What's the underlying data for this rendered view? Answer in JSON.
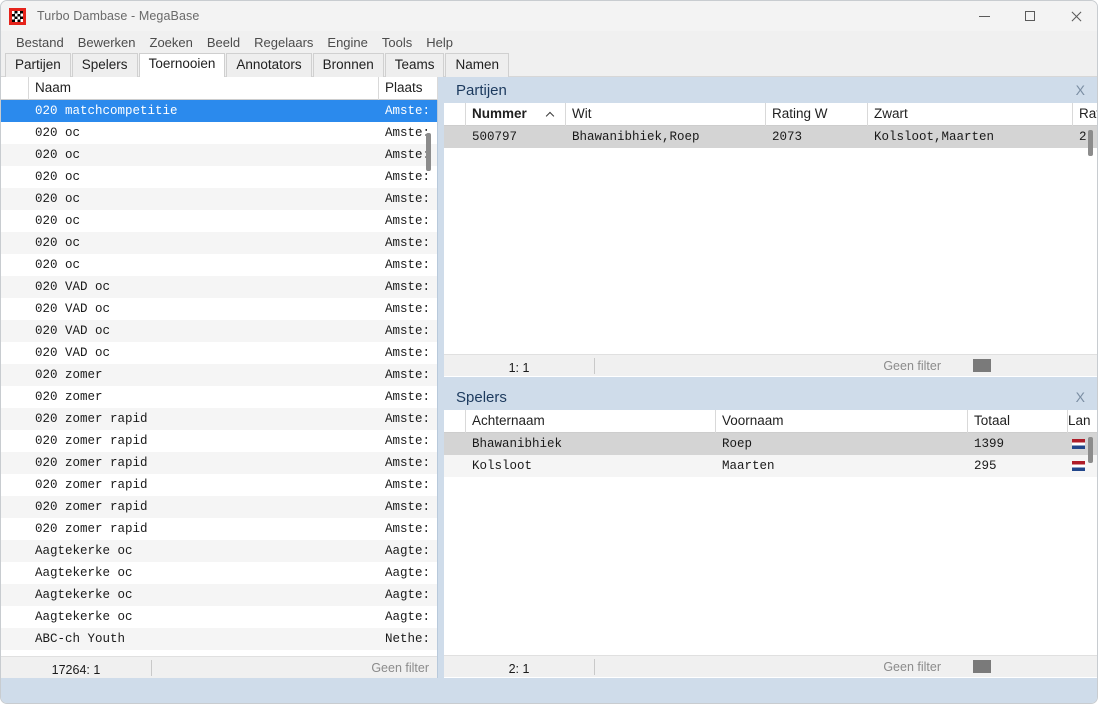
{
  "window": {
    "title": "Turbo Dambase - MegaBase",
    "app_icon": "checkerboard-icon",
    "controls": {
      "minimize": "minimize-icon",
      "maximize": "maximize-icon",
      "close": "close-icon"
    }
  },
  "menubar": {
    "items": [
      "Bestand",
      "Bewerken",
      "Zoeken",
      "Beeld",
      "Regelaars",
      "Engine",
      "Tools",
      "Help"
    ]
  },
  "tabs": {
    "items": [
      "Partijen",
      "Spelers",
      "Toernooien",
      "Annotators",
      "Bronnen",
      "Teams",
      "Namen"
    ],
    "active": "Toernooien"
  },
  "tournaments_grid": {
    "columns": [
      "",
      "Naam",
      "Plaats"
    ],
    "rows": [
      {
        "naam": "020 matchcompetitie",
        "plaats": "Amste:",
        "selected": true
      },
      {
        "naam": "020 oc",
        "plaats": "Amste:"
      },
      {
        "naam": "020 oc",
        "plaats": "Amste:"
      },
      {
        "naam": "020 oc",
        "plaats": "Amste:"
      },
      {
        "naam": "020 oc",
        "plaats": "Amste:"
      },
      {
        "naam": "020 oc",
        "plaats": "Amste:"
      },
      {
        "naam": "020 oc",
        "plaats": "Amste:"
      },
      {
        "naam": "020 oc",
        "plaats": "Amste:"
      },
      {
        "naam": "020 VAD oc",
        "plaats": "Amste:"
      },
      {
        "naam": "020 VAD oc",
        "plaats": "Amste:"
      },
      {
        "naam": "020 VAD oc",
        "plaats": "Amste:"
      },
      {
        "naam": "020 VAD oc",
        "plaats": "Amste:"
      },
      {
        "naam": "020 zomer",
        "plaats": "Amste:"
      },
      {
        "naam": "020 zomer",
        "plaats": "Amste:"
      },
      {
        "naam": "020 zomer rapid",
        "plaats": "Amste:"
      },
      {
        "naam": "020 zomer rapid",
        "plaats": "Amste:"
      },
      {
        "naam": "020 zomer rapid",
        "plaats": "Amste:"
      },
      {
        "naam": "020 zomer rapid",
        "plaats": "Amste:"
      },
      {
        "naam": "020 zomer rapid",
        "plaats": "Amste:"
      },
      {
        "naam": "020 zomer rapid",
        "plaats": "Amste:"
      },
      {
        "naam": "Aagtekerke oc",
        "plaats": "Aagte:"
      },
      {
        "naam": "Aagtekerke oc",
        "plaats": "Aagte:"
      },
      {
        "naam": "Aagtekerke oc",
        "plaats": "Aagte:"
      },
      {
        "naam": "Aagtekerke oc",
        "plaats": "Aagte:"
      },
      {
        "naam": "ABC-ch Youth",
        "plaats": "Nethe:"
      }
    ],
    "status": {
      "count": "17264: 1",
      "filter": "Geen filter"
    }
  },
  "partijen_panel": {
    "caption": "Partijen",
    "close_label": "X",
    "columns": [
      "",
      "Nummer",
      "Wit",
      "Rating W",
      "Zwart",
      "Rati"
    ],
    "sorted_column": "Nummer",
    "sort_direction": "asc",
    "rows": [
      {
        "nummer": "500797",
        "wit": "Bhawanibhiek,Roep",
        "rating_w": "2073",
        "zwart": "Kolsloot,Maarten",
        "rating_z": "2"
      }
    ],
    "status": {
      "count": "1: 1",
      "filter": "Geen filter"
    }
  },
  "spelers_panel": {
    "caption": "Spelers",
    "close_label": "X",
    "columns": [
      "",
      "Achternaam",
      "Voornaam",
      "Totaal",
      "Lan"
    ],
    "rows": [
      {
        "achternaam": "Bhawanibhiek",
        "voornaam": "Roep",
        "totaal": "1399",
        "land": "nl-flag-icon"
      },
      {
        "achternaam": "Kolsloot",
        "voornaam": "Maarten",
        "totaal": "295",
        "land": "nl-flag-icon"
      }
    ],
    "status": {
      "count": "2: 1",
      "filter": "Geen filter"
    }
  },
  "colors": {
    "selection": "#2b8aed",
    "panel_caption_bg": "#cfdcea",
    "app_icon": "#e5231b"
  }
}
